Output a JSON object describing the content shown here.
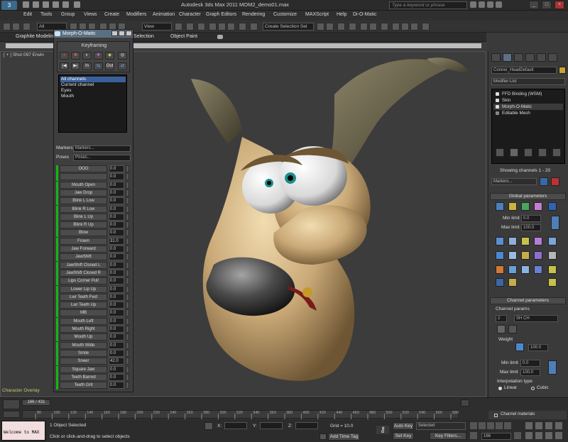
{
  "app": {
    "logo_glyph": "3",
    "title": "Autodesk 3ds Max  2011    MOM2_demo01.max",
    "search_placeholder": "Type a keyword or phrase",
    "window_controls": [
      "_",
      "□",
      "×"
    ]
  },
  "menu": [
    "Edit",
    "Tools",
    "Group",
    "Views",
    "Create",
    "Modifiers",
    "Animation",
    "Character",
    "Graph Editors",
    "Rendering",
    "Customize",
    "MAXScript",
    "Help",
    "Di-O-Matic"
  ],
  "toolbar": {
    "selection_filter": "All",
    "reference_coord": "View",
    "named_selection": "Create Selection Set"
  },
  "ribbon": {
    "tabs": [
      "Graphite Modeling",
      "Selection",
      "Object Paint"
    ]
  },
  "viewport": {
    "label": "[ + ] Shot 097 Erwin",
    "camera_label": "Character Overlay"
  },
  "morph_o_matic": {
    "title": "Morph-O-Matic",
    "keyframing_label": "Keyframing",
    "key_buttons_row1": [
      "●",
      "✱",
      "◐",
      "✚",
      "◆",
      "◎"
    ],
    "key_buttons_row2": [
      "|◀",
      "▶|",
      "In",
      "⇆",
      "Out",
      "⇄"
    ],
    "channel_list": [
      "All channels",
      "Current channel",
      "Eyes",
      "Mouth"
    ],
    "markers_label": "Markers",
    "markers_value": "Markers...",
    "poses_label": "Poses",
    "poses_value": "Poses...",
    "channels": [
      {
        "name": "OOO",
        "value": "0.0"
      },
      {
        "name": "",
        "value": "0.0"
      },
      {
        "name": "Mouth Open",
        "value": "0.0"
      },
      {
        "name": "Jaw Drop",
        "value": "0.0"
      },
      {
        "name": "Blink L Low",
        "value": "0.0"
      },
      {
        "name": "Blink R Low",
        "value": "0.0"
      },
      {
        "name": "Blink L Up",
        "value": "0.0"
      },
      {
        "name": "Blink R Up",
        "value": "0.0"
      },
      {
        "name": "Blow",
        "value": "0.0"
      },
      {
        "name": "Frown",
        "value": "31.0"
      },
      {
        "name": "Jaw Forward",
        "value": "0.0"
      },
      {
        "name": "JawShift",
        "value": "0.0"
      },
      {
        "name": "JawShift Closed L",
        "value": "0.0"
      },
      {
        "name": "JawShift Closed R",
        "value": "0.0"
      },
      {
        "name": "Lips Corner Pull",
        "value": "0.0"
      },
      {
        "name": "Lower Lip Up",
        "value": "0.0"
      },
      {
        "name": "Lwr Teeth Fwd",
        "value": "0.0"
      },
      {
        "name": "Lwr Teeth Up",
        "value": "0.0"
      },
      {
        "name": "MB",
        "value": "0.0"
      },
      {
        "name": "Mouth Left",
        "value": "0.0"
      },
      {
        "name": "Mouth Right",
        "value": "0.0"
      },
      {
        "name": "Mouth Up",
        "value": "0.0"
      },
      {
        "name": "Mouth Wide",
        "value": "0.0"
      },
      {
        "name": "Smile",
        "value": "0.0"
      },
      {
        "name": "Sneer",
        "value": "42.0"
      },
      {
        "name": "Square Jaw",
        "value": "0.0"
      },
      {
        "name": "Teeth Barred",
        "value": "0.0"
      },
      {
        "name": "Teeth Grit",
        "value": "0.0"
      }
    ]
  },
  "command_panel": {
    "object_name": "Conner_HeadDefault",
    "modifier_list": "Modifier List",
    "stack": [
      "FFD Binding (WSM)",
      "Skin",
      "Morph-O-Matic",
      "Editable Mesh"
    ],
    "showing_channels": "Showing channels 1 - 20",
    "markers_value": "Markers...",
    "global_params_label": "Global parameters",
    "min_limit_label": "Min limit",
    "min_limit_value": "0.0",
    "max_limit_label": "Max limit",
    "max_limit_value": "100.0",
    "channel_params_rollout": "Channel parameters",
    "channel_params_label": "Channel params",
    "channel_index": "2",
    "channel_name": "SH CH",
    "weight_label": "Weight",
    "weight_value": "100.0",
    "ch_min_label": "Min limit",
    "ch_min_value": "0.0",
    "ch_max_label": "Max limit",
    "ch_max_value": "100.0",
    "interp_label": "Interpolation type",
    "interp_linear": "Linear",
    "interp_cubic": "Cubic",
    "channel_materials": "Channel materials"
  },
  "timeline": {
    "slider": "166 / 431",
    "ticks": [
      "80",
      "100",
      "120",
      "140",
      "160",
      "180",
      "200",
      "220",
      "240",
      "260",
      "280",
      "300",
      "320",
      "340",
      "360",
      "380",
      "400",
      "420",
      "440",
      "460",
      "480",
      "500",
      "520",
      "540",
      "560",
      "580"
    ]
  },
  "status": {
    "maxscript": "Welcome to MAX",
    "objects_selected": "1 Object Selected",
    "prompt": "Click or click-and-drag to select objects",
    "x_label": "X:",
    "y_label": "Y:",
    "z_label": "Z:",
    "grid": "Grid = 10.0",
    "add_time_tag": "Add Time Tag",
    "auto_key": "Auto Key",
    "set_key": "Set Key",
    "key_mode": "Selected",
    "key_filters": "Key Filters...",
    "current_frame": "166"
  },
  "colors": {
    "channel_indicator": "#14b814",
    "selection_highlight": "#3a5f9a",
    "dialog_title": "#5b6f83"
  }
}
